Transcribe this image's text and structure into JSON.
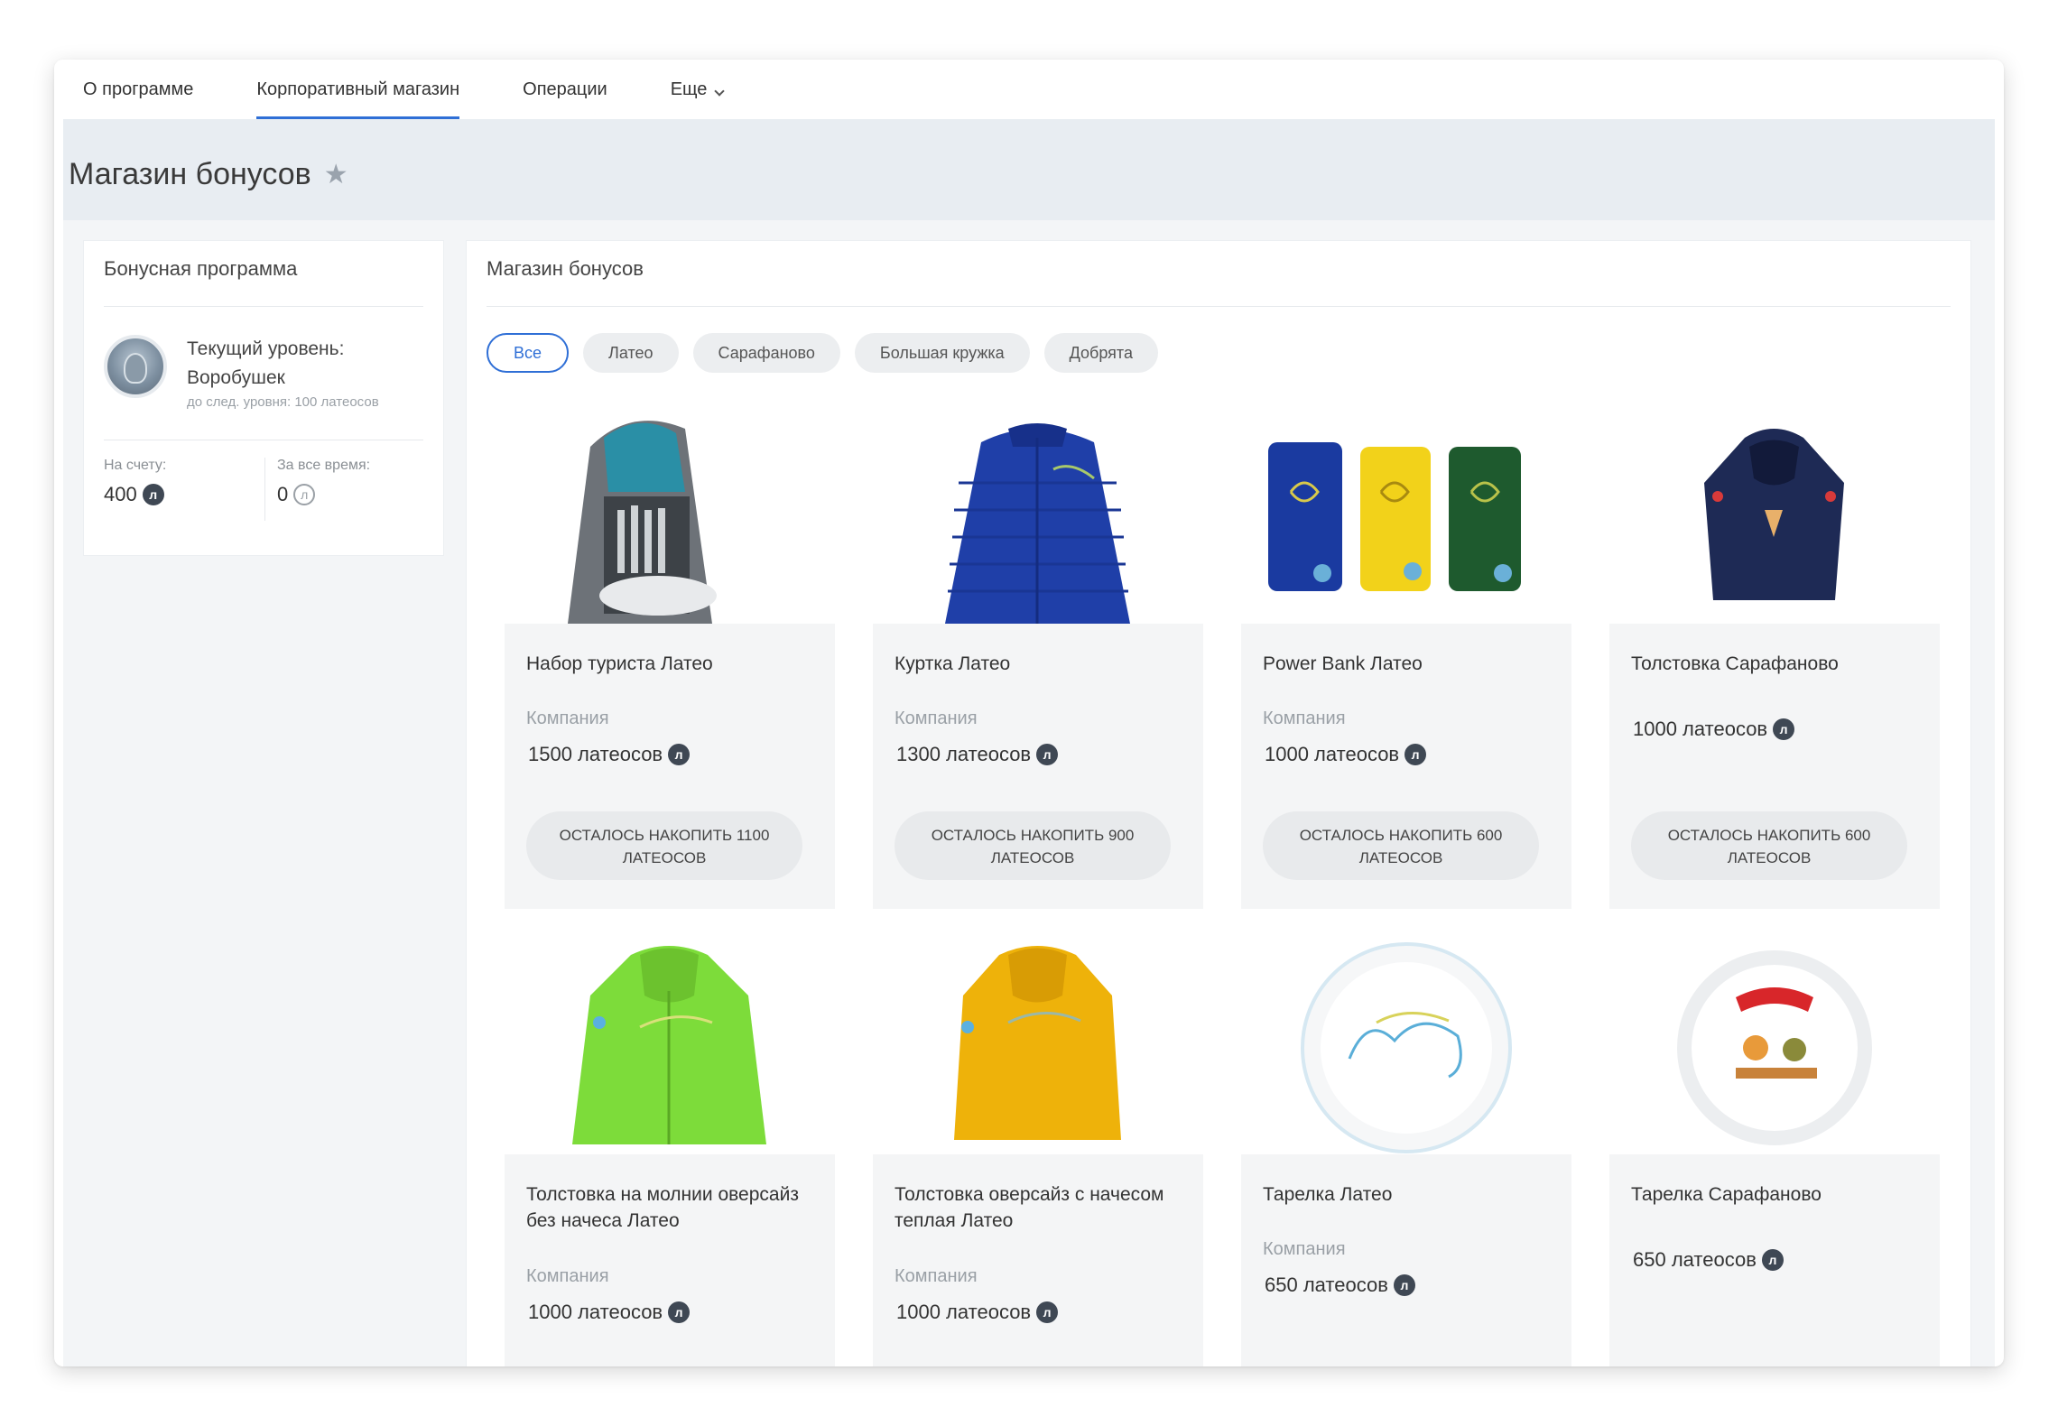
{
  "nav": {
    "tabs": [
      {
        "label": "О программе"
      },
      {
        "label": "Корпоративный магазин"
      },
      {
        "label": "Операции"
      },
      {
        "label": "Еще"
      }
    ]
  },
  "page": {
    "title": "Магазин бонусов"
  },
  "bonus": {
    "header": "Бонусная программа",
    "level_line1": "Текущий уровень:",
    "level_line2": "Воробушек",
    "next_level": "до след. уровня: 100 латеосов",
    "balance_label": "На счету:",
    "balance_value": "400",
    "total_label": "За все время:",
    "total_value": "0",
    "coin_glyph": "л"
  },
  "shop": {
    "header": "Магазин бонусов",
    "filters": [
      "Все",
      "Латео",
      "Сарафаново",
      "Большая кружка",
      "Добрята"
    ],
    "company_label": "Компания",
    "products": [
      {
        "title": "Набор туриста Латео",
        "price": "1500 латеосов",
        "btn1": "ОСТАЛОСЬ НАКОПИТЬ 1100",
        "btn2": "ЛАТЕОСОВ"
      },
      {
        "title": "Куртка Латео",
        "price": "1300 латеосов",
        "btn1": "ОСТАЛОСЬ НАКОПИТЬ 900",
        "btn2": "ЛАТЕОСОВ"
      },
      {
        "title": "Power Bank Латео",
        "price": "1000 латеосов",
        "btn1": "ОСТАЛОСЬ НАКОПИТЬ 600",
        "btn2": "ЛАТЕОСОВ"
      },
      {
        "title": "Толстовка Сарафаново",
        "price": "1000 латеосов",
        "btn1": "ОСТАЛОСЬ НАКОПИТЬ 600",
        "btn2": "ЛАТЕОСОВ"
      },
      {
        "title": "Толстовка на молнии оверсайз без начеса Латео",
        "price": "1000 латеосов"
      },
      {
        "title": "Толстовка оверсайз с начесом теплая Латео",
        "price": "1000 латеосов"
      },
      {
        "title": "Тарелка Латео",
        "price": "650 латеосов"
      },
      {
        "title": "Тарелка Сарафаново",
        "price": "650 латеосов"
      }
    ]
  },
  "colors": {
    "accent": "#2f6fd6",
    "coin": "#3f4854"
  },
  "icons": {
    "star": "star-icon",
    "chevron": "chevron-down-icon"
  }
}
